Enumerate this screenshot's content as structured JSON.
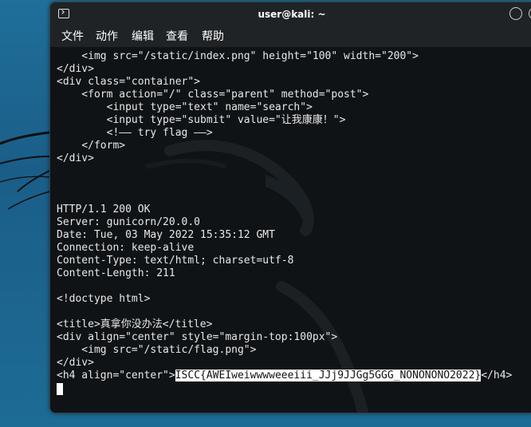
{
  "window": {
    "title": "user@kali: ~",
    "terminal_icon": "terminal-icon",
    "minimize_icon": "minimize-icon",
    "maximize_icon": "maximize-icon"
  },
  "menubar": {
    "items": [
      {
        "label": "文件"
      },
      {
        "label": "动作"
      },
      {
        "label": "编辑"
      },
      {
        "label": "查看"
      },
      {
        "label": "帮助"
      }
    ]
  },
  "terminal": {
    "lines": [
      "    <img src=\"/static/index.png\" height=\"100\" width=\"200\">",
      "</div>",
      "<div class=\"container\">",
      "    <form action=\"/\" class=\"parent\" method=\"post\">",
      "        <input type=\"text\" name=\"search\">",
      "        <input type=\"submit\" value=\"让我康康！\">",
      "        <!—— try flag ——>",
      "    </form>",
      "</div>",
      "",
      "",
      "",
      "HTTP/1.1 200 OK",
      "Server: gunicorn/20.0.0",
      "Date: Tue, 03 May 2022 15:35:12 GMT",
      "Connection: keep-alive",
      "Content-Type: text/html; charset=utf-8",
      "Content-Length: 211",
      "",
      "<!doctype html>",
      "",
      "<title>真拿你没办法</title>",
      "<div align=\"center\" style=\"margin-top:100px\">",
      "    <img src=\"/static/flag.png\">",
      "</div>"
    ],
    "last_line": {
      "prefix": "<h4 align=\"center\">",
      "selected": "ISCC{AWEIweiwwwweeeiii_JJj9JJGg5GGG_NONONONO2022}",
      "suffix": "</h4>"
    }
  },
  "colors": {
    "terminal_bg": "#0f1316",
    "titlebar_bg": "#1f2326",
    "desktop_bg": "#1d6c96",
    "text": "#e8e8e8"
  }
}
